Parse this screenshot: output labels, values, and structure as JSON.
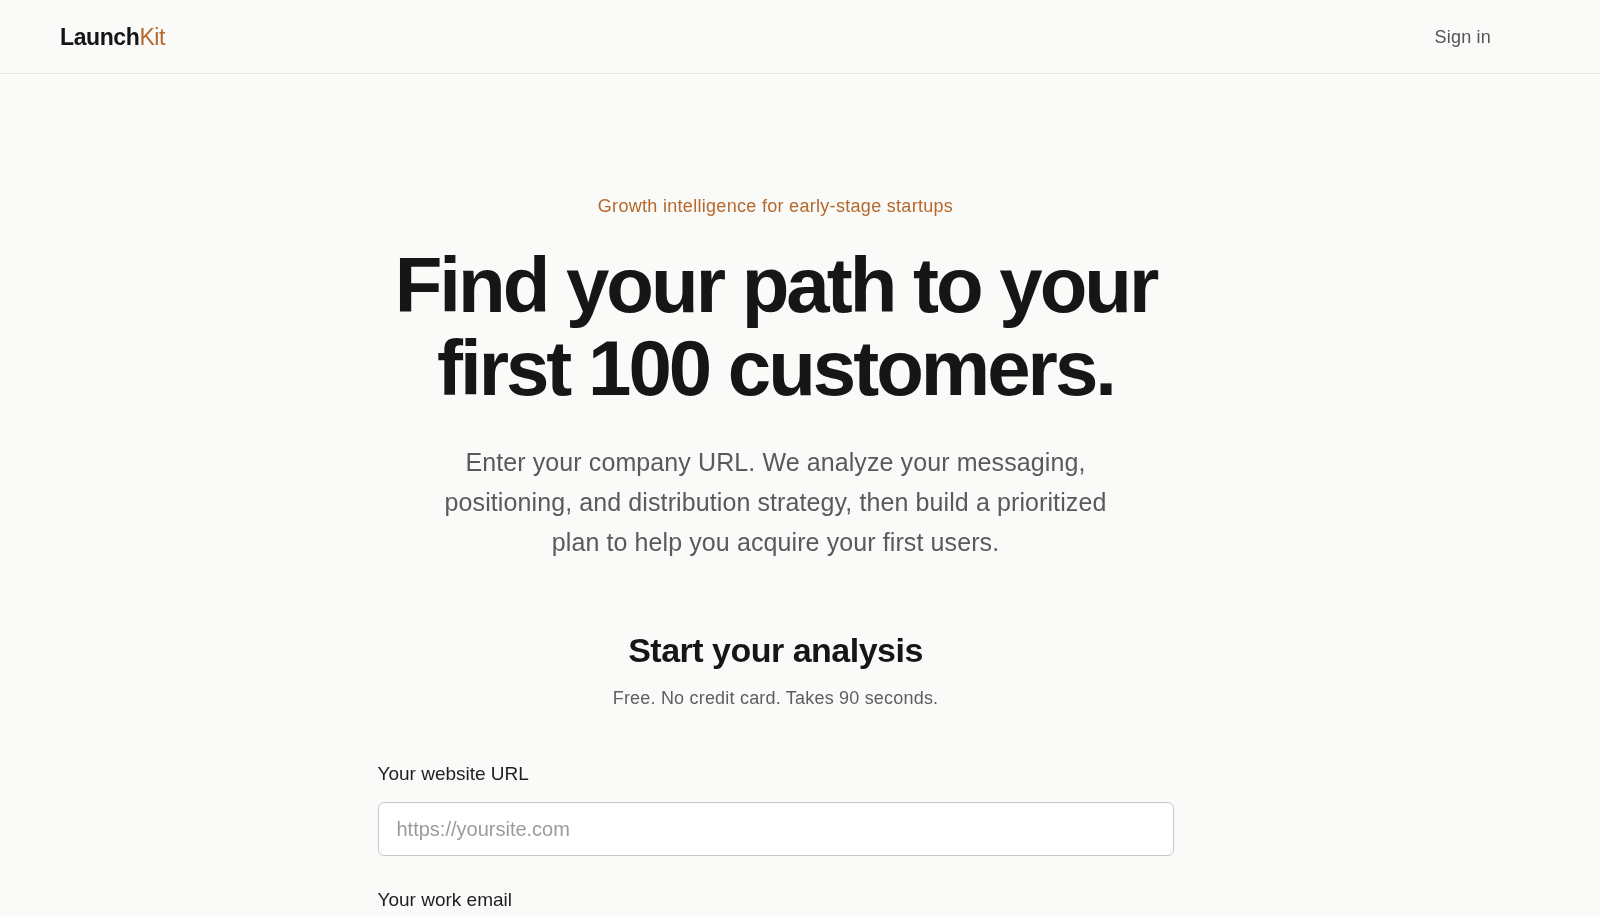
{
  "header": {
    "logo": {
      "primary": "Launch",
      "accent": "Kit"
    },
    "sign_in": "Sign in"
  },
  "hero": {
    "eyebrow": "Growth intelligence for early-stage startups",
    "headline_lines": [
      "Find your path to your",
      "first 100 customers."
    ],
    "description": "Enter your company URL. We analyze your messaging, positioning, and distribution strategy, then build a prioritized plan to help you acquire your first users."
  },
  "form": {
    "title": "Start your analysis",
    "subtitle": "Free. No credit card. Takes 90 seconds.",
    "fields": [
      {
        "label": "Your website URL",
        "placeholder": "https://yoursite.com"
      },
      {
        "label": "Your work email"
      }
    ]
  }
}
